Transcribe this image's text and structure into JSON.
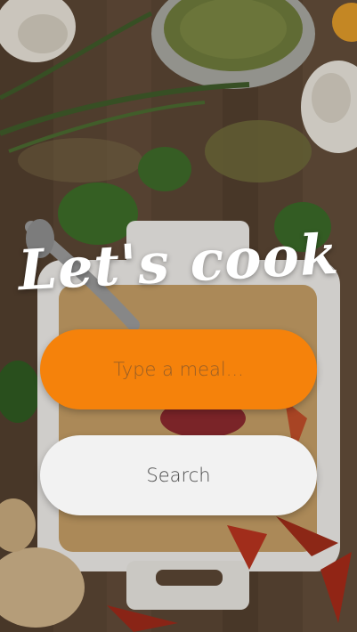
{
  "header": {
    "title": "Let's cook"
  },
  "search": {
    "placeholder": "Type a meal...",
    "button_label": "Search"
  },
  "colors": {
    "accent": "#f5820b",
    "button_bg": "#f2f2f2",
    "title": "#ffffff"
  },
  "background": {
    "icon": "spices-and-herbs-photo"
  }
}
